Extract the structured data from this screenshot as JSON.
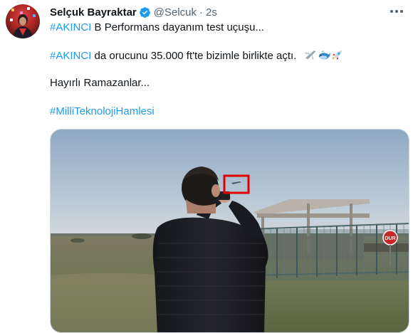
{
  "user": {
    "display_name": "Selçuk Bayraktar",
    "handle": "@Selcuk",
    "separator": "·",
    "timestamp": "2s",
    "verified": true
  },
  "tweet": {
    "line1_tag": "#AKINCI",
    "line1_text": " B Performans dayanım test uçuşu...",
    "line2_tag": "#AKINCI",
    "line2_text": " da orucunu 35.000 ft'te bizimle birlikte açtı.",
    "line2_emojis": [
      "airplane-icon",
      "whale-icon",
      "rocket-icon"
    ],
    "line3_text": "Hayırlı Ramazanlar...",
    "line4_tag": "#MilliTeknolojiHamlesi"
  },
  "media": {
    "type": "photo",
    "sign_text": "DUR",
    "highlight_box_color": "#e00000"
  },
  "colors": {
    "accent": "#1d9bf0",
    "text_primary": "#0f1419",
    "text_secondary": "#536471"
  }
}
